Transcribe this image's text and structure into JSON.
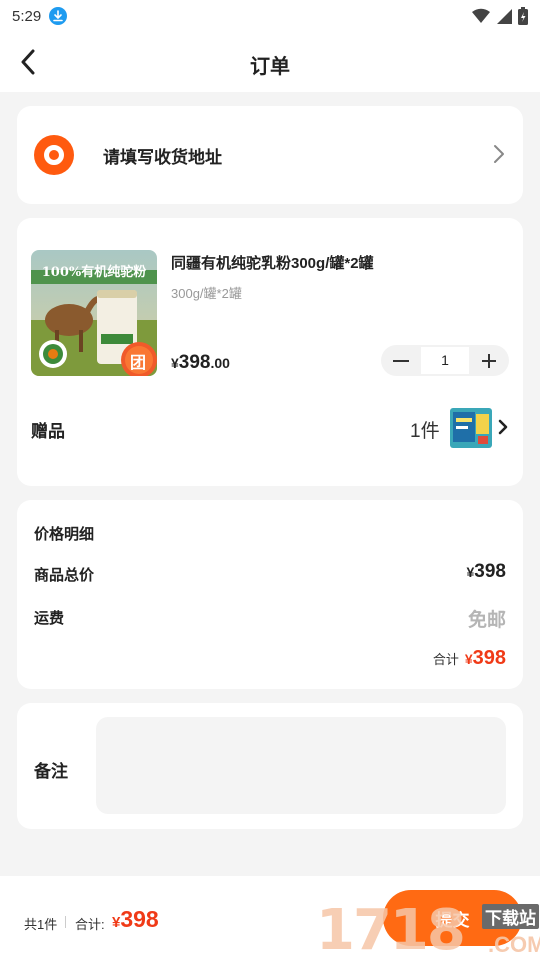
{
  "status_bar": {
    "time": "5:29"
  },
  "nav": {
    "title": "订单"
  },
  "address": {
    "placeholder": "请填写收货地址"
  },
  "product": {
    "name": "同疆有机纯驼乳粉300g/罐*2罐",
    "spec": "300g/罐*2罐",
    "price_currency": "¥",
    "price_integer": "398",
    "price_decimal": ".00",
    "quantity": "1",
    "image_banner": "100%有机纯驼粉",
    "image_badge": "团"
  },
  "gift": {
    "label": "赠品",
    "count": "1件"
  },
  "price_detail": {
    "title": "价格明细",
    "goods_total_label": "商品总价",
    "goods_total_currency": "¥",
    "goods_total_value": "398",
    "shipping_label": "运费",
    "shipping_value": "免邮",
    "sum_label": "合计",
    "sum_currency": "¥",
    "sum_value": "398"
  },
  "note": {
    "label": "备注",
    "placeholder": ""
  },
  "bottom": {
    "count": "共1件",
    "total_label": "合计:",
    "total_currency": "¥",
    "total_value": "398",
    "submit_label": "提交"
  },
  "watermark": {
    "number": "1718",
    "site": "下载站",
    "domain": ".COM"
  },
  "colors": {
    "accent": "#ff6a13",
    "price_red": "#f03a17",
    "pin_orange": "#ff5a0f",
    "background": "#f4f4f4"
  }
}
